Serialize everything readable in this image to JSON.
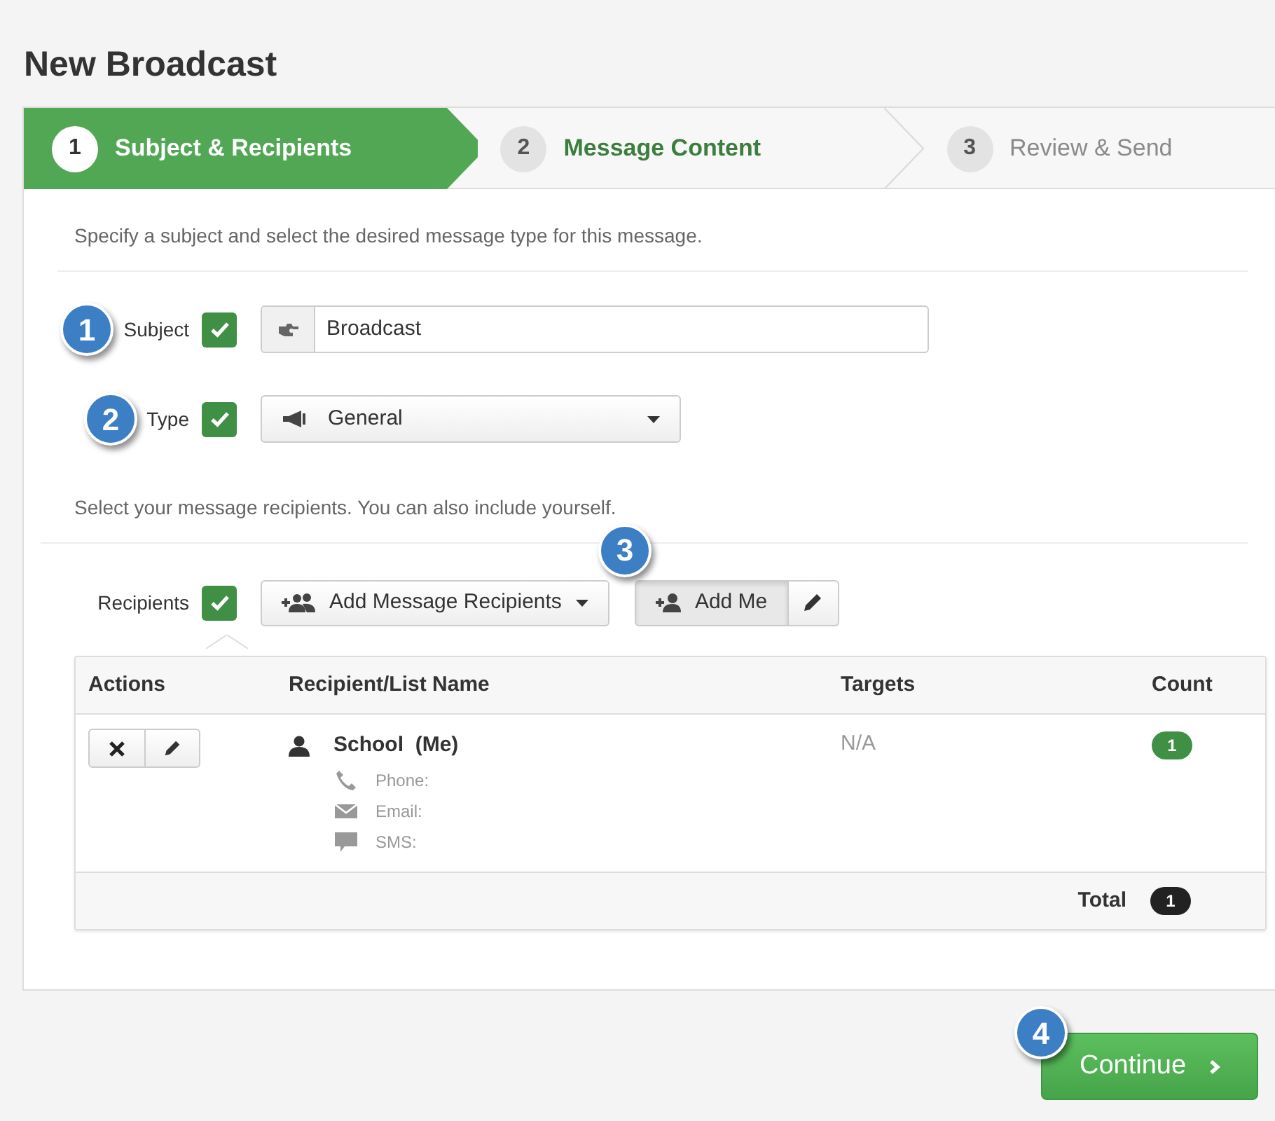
{
  "title": "New Broadcast",
  "steps": [
    {
      "number": "1",
      "label": "Subject & Recipients",
      "selected": true,
      "disabled": false
    },
    {
      "number": "2",
      "label": "Message Content",
      "selected": false,
      "disabled": false
    },
    {
      "number": "3",
      "label": "Review & Send",
      "selected": false,
      "disabled": true
    }
  ],
  "intro": "Specify a subject and select the desired message type for this message.",
  "subject": {
    "label": "Subject",
    "checked": true,
    "value": "Broadcast",
    "callout": "1"
  },
  "type": {
    "label": "Type",
    "checked": true,
    "value": "General",
    "callout": "2"
  },
  "recipients_intro": "Select your message recipients. You can also include yourself.",
  "recipients": {
    "label": "Recipients",
    "checked": true,
    "add_button": "Add Message Recipients",
    "add_me_button": "Add Me",
    "callout": "3"
  },
  "table": {
    "columns": [
      "Actions",
      "Recipient/List Name",
      "Targets",
      "Count"
    ],
    "rows": [
      {
        "name": "School  (Me)",
        "details": [
          {
            "kind": "phone",
            "label": "Phone:"
          },
          {
            "kind": "email",
            "label": "Email:"
          },
          {
            "kind": "sms",
            "label": "SMS:"
          }
        ],
        "targets": "N/A",
        "count": "1"
      }
    ],
    "total_label": "Total",
    "total": "1"
  },
  "continue": {
    "label": "Continue",
    "callout": "4"
  }
}
